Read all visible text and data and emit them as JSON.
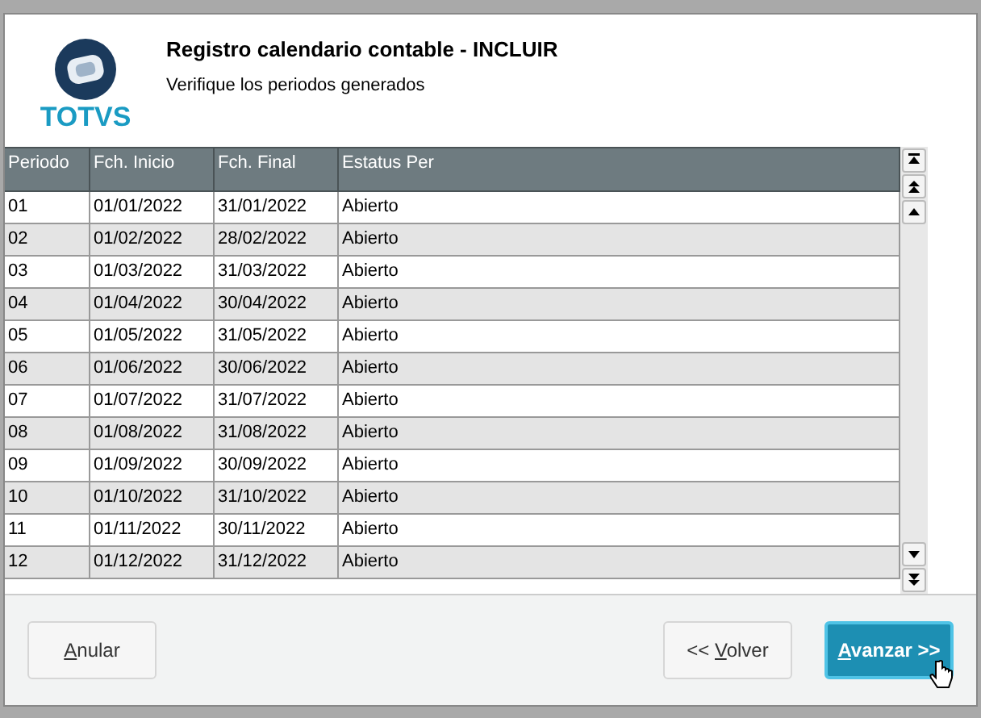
{
  "logo": {
    "text": "TOTVS"
  },
  "header": {
    "title": "Registro calendario contable - INCLUIR",
    "subtitle": "Verifique los periodos generados"
  },
  "table": {
    "columns": [
      "Periodo",
      "Fch. Inicio",
      "Fch. Final",
      "Estatus Per"
    ],
    "rows": [
      [
        "01",
        "01/01/2022",
        "31/01/2022",
        "Abierto"
      ],
      [
        "02",
        "01/02/2022",
        "28/02/2022",
        "Abierto"
      ],
      [
        "03",
        "01/03/2022",
        "31/03/2022",
        "Abierto"
      ],
      [
        "04",
        "01/04/2022",
        "30/04/2022",
        "Abierto"
      ],
      [
        "05",
        "01/05/2022",
        "31/05/2022",
        "Abierto"
      ],
      [
        "06",
        "01/06/2022",
        "30/06/2022",
        "Abierto"
      ],
      [
        "07",
        "01/07/2022",
        "31/07/2022",
        "Abierto"
      ],
      [
        "08",
        "01/08/2022",
        "31/08/2022",
        "Abierto"
      ],
      [
        "09",
        "01/09/2022",
        "30/09/2022",
        "Abierto"
      ],
      [
        "10",
        "01/10/2022",
        "31/10/2022",
        "Abierto"
      ],
      [
        "11",
        "01/11/2022",
        "30/11/2022",
        "Abierto"
      ],
      [
        "12",
        "01/12/2022",
        "31/12/2022",
        "Abierto"
      ]
    ]
  },
  "buttons": [
    {
      "kind": "secondary",
      "key": "A",
      "after": "nular"
    },
    {
      "kind": "secondary",
      "before": "<< ",
      "key": "V",
      "after": "olver"
    },
    {
      "kind": "primary",
      "key": "A",
      "after": "vanzar >>"
    }
  ]
}
